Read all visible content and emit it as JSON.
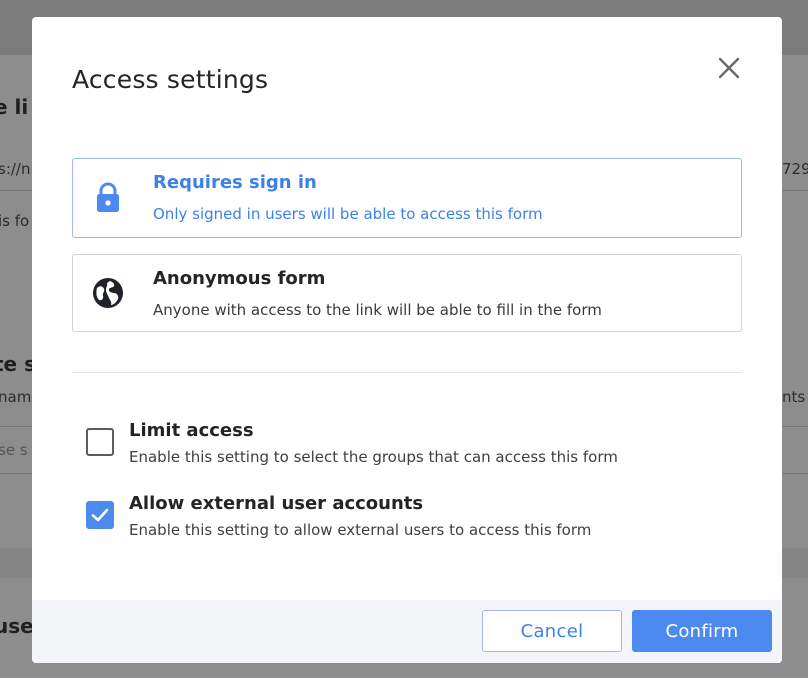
{
  "background": {
    "fragments": {
      "heading_link": "e li",
      "url_start": "s://n",
      "url_end": "729",
      "text_form": "is fo",
      "heading_te": "te s",
      "text_nam": "nam",
      "text_nts": "nts",
      "text_se_s": "se s",
      "heading_use": "use"
    }
  },
  "dialog": {
    "title": "Access settings",
    "close_icon": "close-icon",
    "options": [
      {
        "title": "Requires sign in",
        "description": "Only signed in users will be able to access this form",
        "icon": "lock-icon",
        "selected": true
      },
      {
        "title": "Anonymous form",
        "description": "Anyone with access to the link will be able to fill in the form",
        "icon": "globe-icon",
        "selected": false
      }
    ],
    "checkboxes": [
      {
        "title": "Limit access",
        "description": "Enable this setting to select the groups that can access this form",
        "checked": false
      },
      {
        "title": "Allow external user accounts",
        "description": "Enable this setting to allow external users to access this form",
        "checked": true
      }
    ],
    "footer": {
      "cancel_label": "Cancel",
      "confirm_label": "Confirm"
    }
  },
  "colors": {
    "accent": "#4d8af0",
    "accent_text": "#3c82e6",
    "overlay": "#8d8d8d"
  }
}
